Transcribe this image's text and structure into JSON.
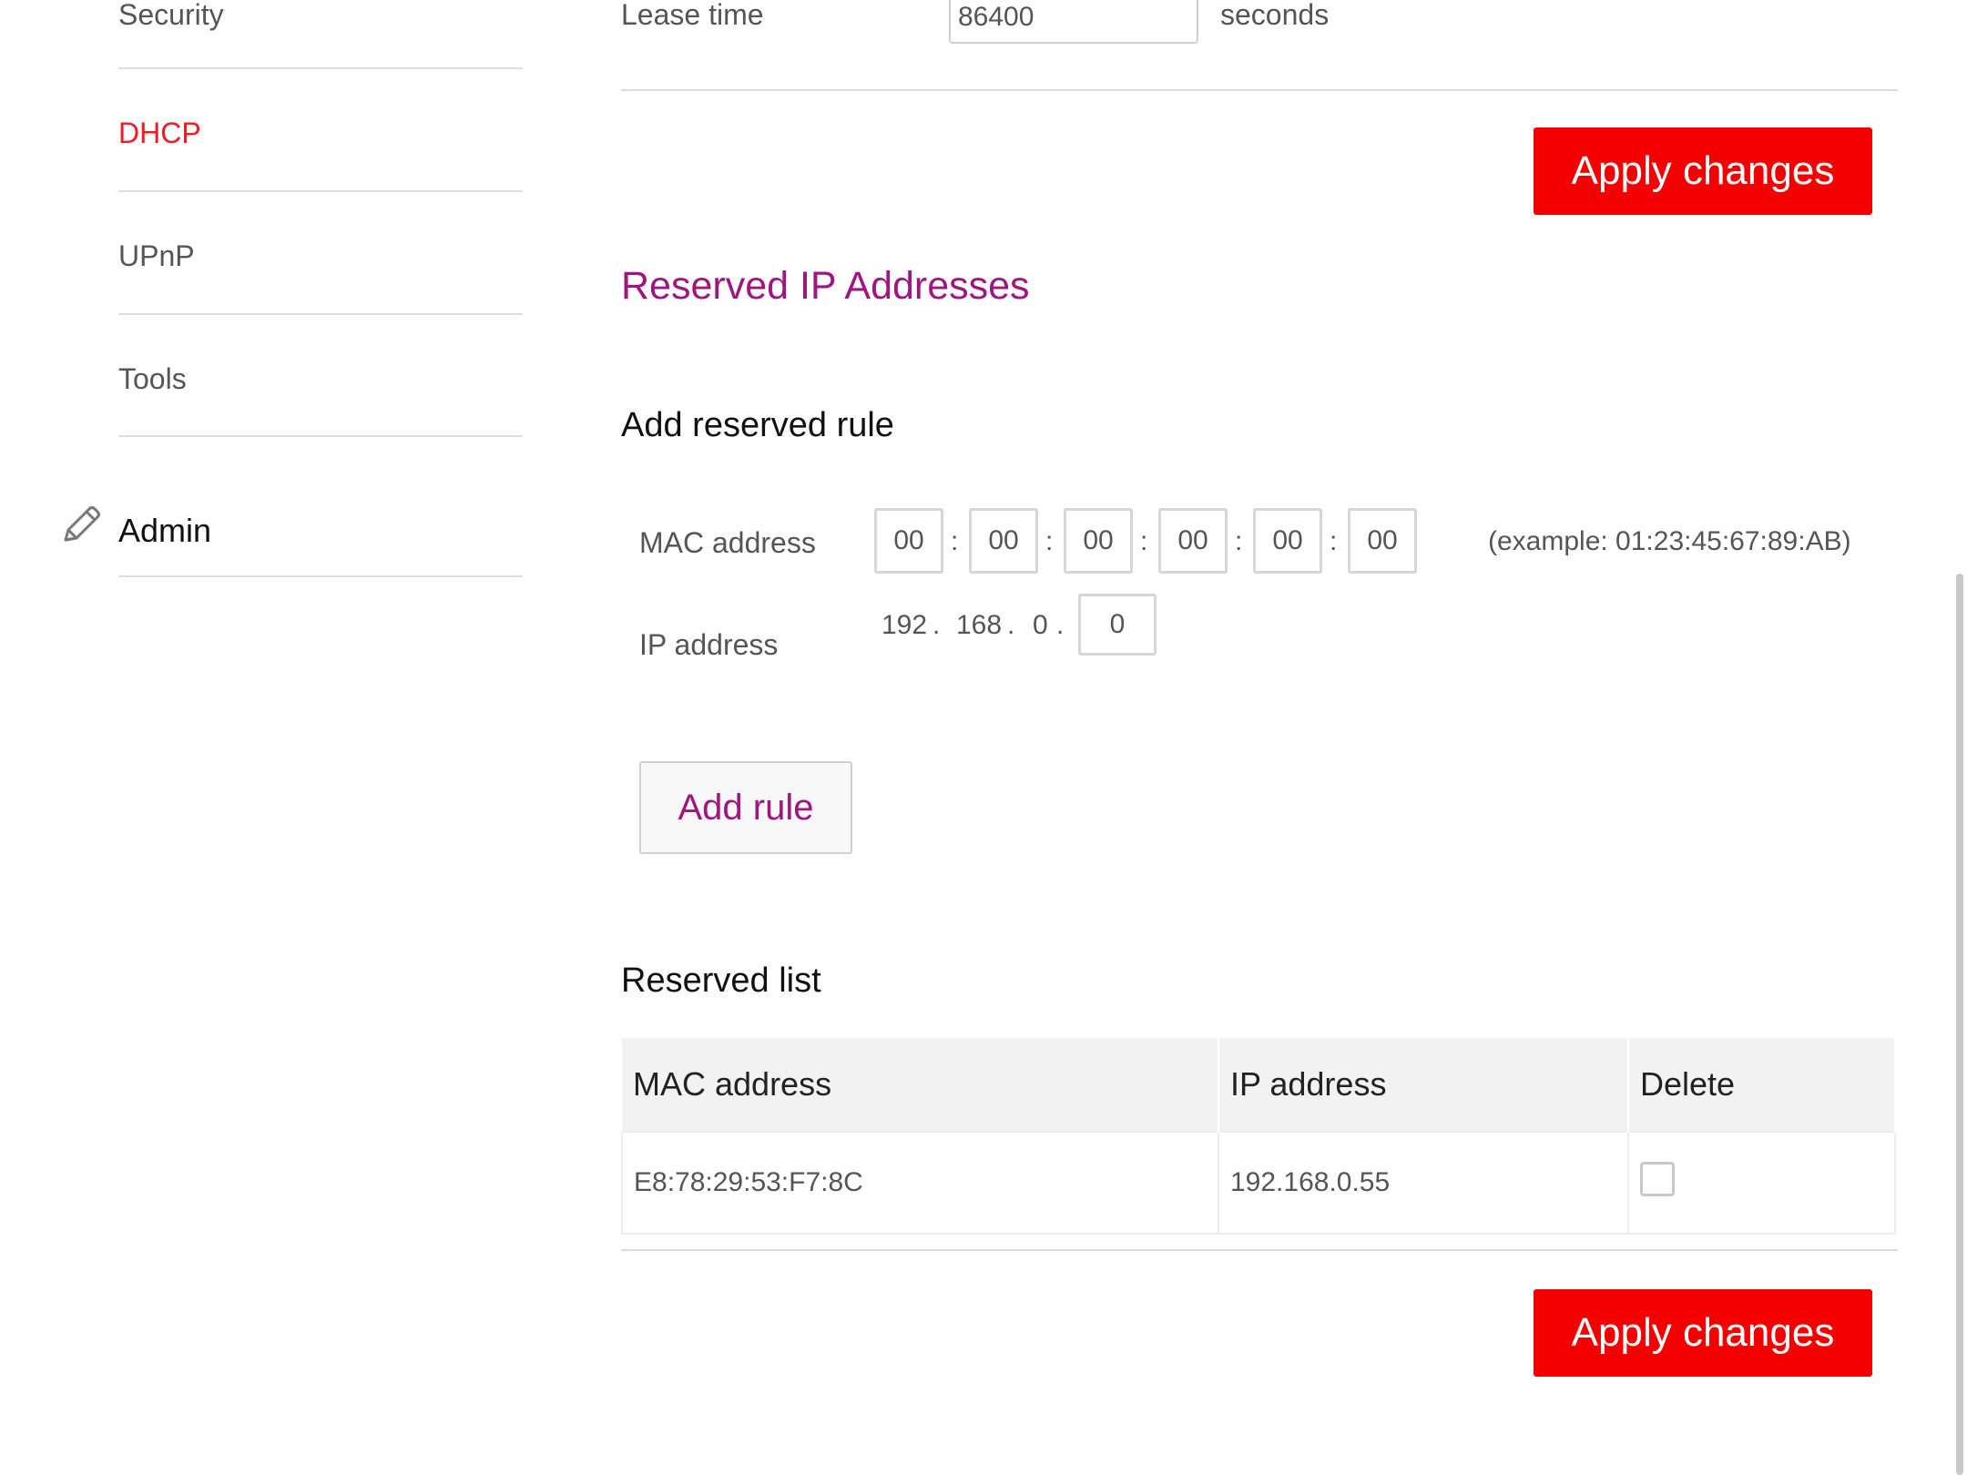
{
  "sidebar": {
    "items": [
      {
        "label": "Security"
      },
      {
        "label": "DHCP",
        "active": true
      },
      {
        "label": "UPnP"
      },
      {
        "label": "Tools"
      }
    ],
    "admin_label": "Admin",
    "admin_icon": "pencil-icon"
  },
  "lease": {
    "label": "Lease time",
    "value": "86400",
    "unit": "seconds"
  },
  "apply_label": "Apply changes",
  "reserved": {
    "title": "Reserved IP Addresses",
    "add_rule_title": "Add reserved rule",
    "mac_label": "MAC address",
    "mac_octets": [
      "00",
      "00",
      "00",
      "00",
      "00",
      "00"
    ],
    "mac_separator": ":",
    "mac_example": "(example: 01:23:45:67:89:AB)",
    "ip_label": "IP address",
    "ip_prefix": [
      "192",
      "168",
      "0"
    ],
    "ip_separator": ".",
    "ip_last_octet": "0",
    "add_rule_button": "Add rule",
    "list_title": "Reserved list",
    "table": {
      "headers": [
        "MAC address",
        "IP address",
        "Delete"
      ],
      "rows": [
        {
          "mac": "E8:78:29:53:F7:8C",
          "ip": "192.168.0.55",
          "delete_checked": false
        }
      ]
    }
  },
  "colors": {
    "accent_red": "#f40000",
    "active_nav": "#ee1c25",
    "heading_purple": "#a0157f"
  }
}
